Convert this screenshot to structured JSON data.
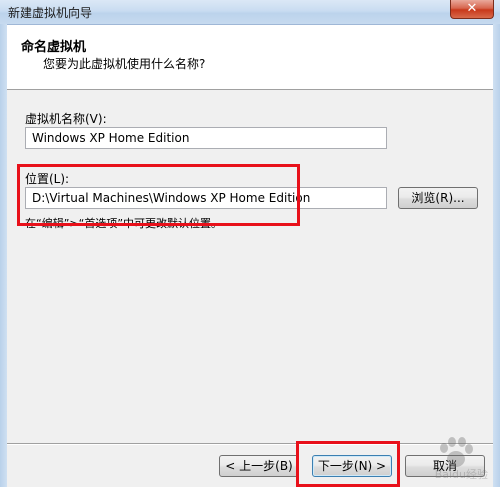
{
  "window": {
    "title": "新建虚拟机向导",
    "close_label": "✕"
  },
  "header": {
    "title": "命名虚拟机",
    "subtitle": "您要为此虚拟机使用什么名称?"
  },
  "form": {
    "vm_name_label": "虚拟机名称(V):",
    "vm_name_value": "Windows XP Home Edition",
    "location_label": "位置(L):",
    "location_value": "D:\\Virtual Machines\\Windows XP Home Edition",
    "browse_label": "浏览(R)...",
    "hint": "在“编辑”>“首选项”中可更改默认位置。"
  },
  "footer": {
    "back_label": "< 上一步(B)",
    "next_label": "下一步(N) >",
    "cancel_label": "取消"
  },
  "watermark": {
    "text": "Baidu经验"
  },
  "colors": {
    "annotation_red": "#e8101a",
    "default_button_border": "#3c7fb1"
  }
}
